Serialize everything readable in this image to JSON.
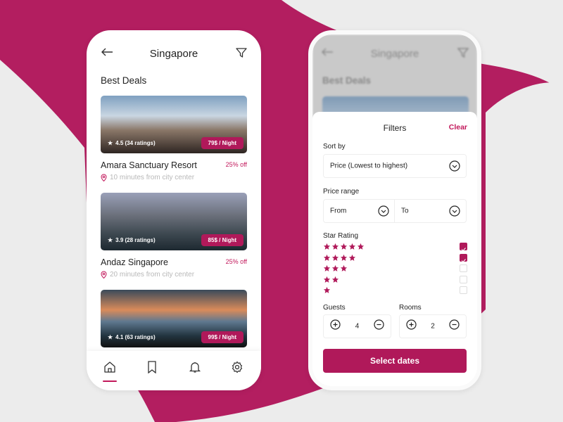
{
  "colors": {
    "accent": "#b0195a",
    "background": "#ececec",
    "blob": "#b31e60"
  },
  "list_screen": {
    "header": {
      "title": "Singapore",
      "back_icon": "arrow-left-icon",
      "filter_icon": "filter-icon"
    },
    "section_title": "Best Deals",
    "hotels": [
      {
        "name": "Amara Sanctuary Resort",
        "rating": "4.5 (34 ratings)",
        "price": "79$ / Night",
        "discount": "25% off",
        "location": "10 minutes from city center"
      },
      {
        "name": "Andaz Singapore",
        "rating": "3.9 (28 ratings)",
        "price": "85$ / Night",
        "discount": "25% off",
        "location": "20 minutes from city center"
      },
      {
        "name": "",
        "rating": "4.1 (63 ratings)",
        "price": "99$ / Night",
        "discount": "",
        "location": ""
      }
    ],
    "nav": [
      {
        "icon": "home-icon",
        "active": true
      },
      {
        "icon": "bookmark-icon",
        "active": false
      },
      {
        "icon": "bell-icon",
        "active": false
      },
      {
        "icon": "settings-icon",
        "active": false
      }
    ]
  },
  "filter_screen": {
    "background": {
      "title": "Singapore",
      "section_title": "Best Deals"
    },
    "title": "Filters",
    "clear_label": "Clear",
    "sort_by": {
      "label": "Sort by",
      "value": "Price (Lowest to highest)"
    },
    "price_range": {
      "label": "Price range",
      "from": "From",
      "to": "To"
    },
    "star_rating": {
      "label": "Star Rating",
      "options": [
        {
          "stars": 5,
          "checked": true
        },
        {
          "stars": 4,
          "checked": true
        },
        {
          "stars": 3,
          "checked": false
        },
        {
          "stars": 2,
          "checked": false
        },
        {
          "stars": 1,
          "checked": false
        }
      ]
    },
    "guests": {
      "label": "Guests",
      "value": "4"
    },
    "rooms": {
      "label": "Rooms",
      "value": "2"
    },
    "select_dates_label": "Select dates"
  }
}
